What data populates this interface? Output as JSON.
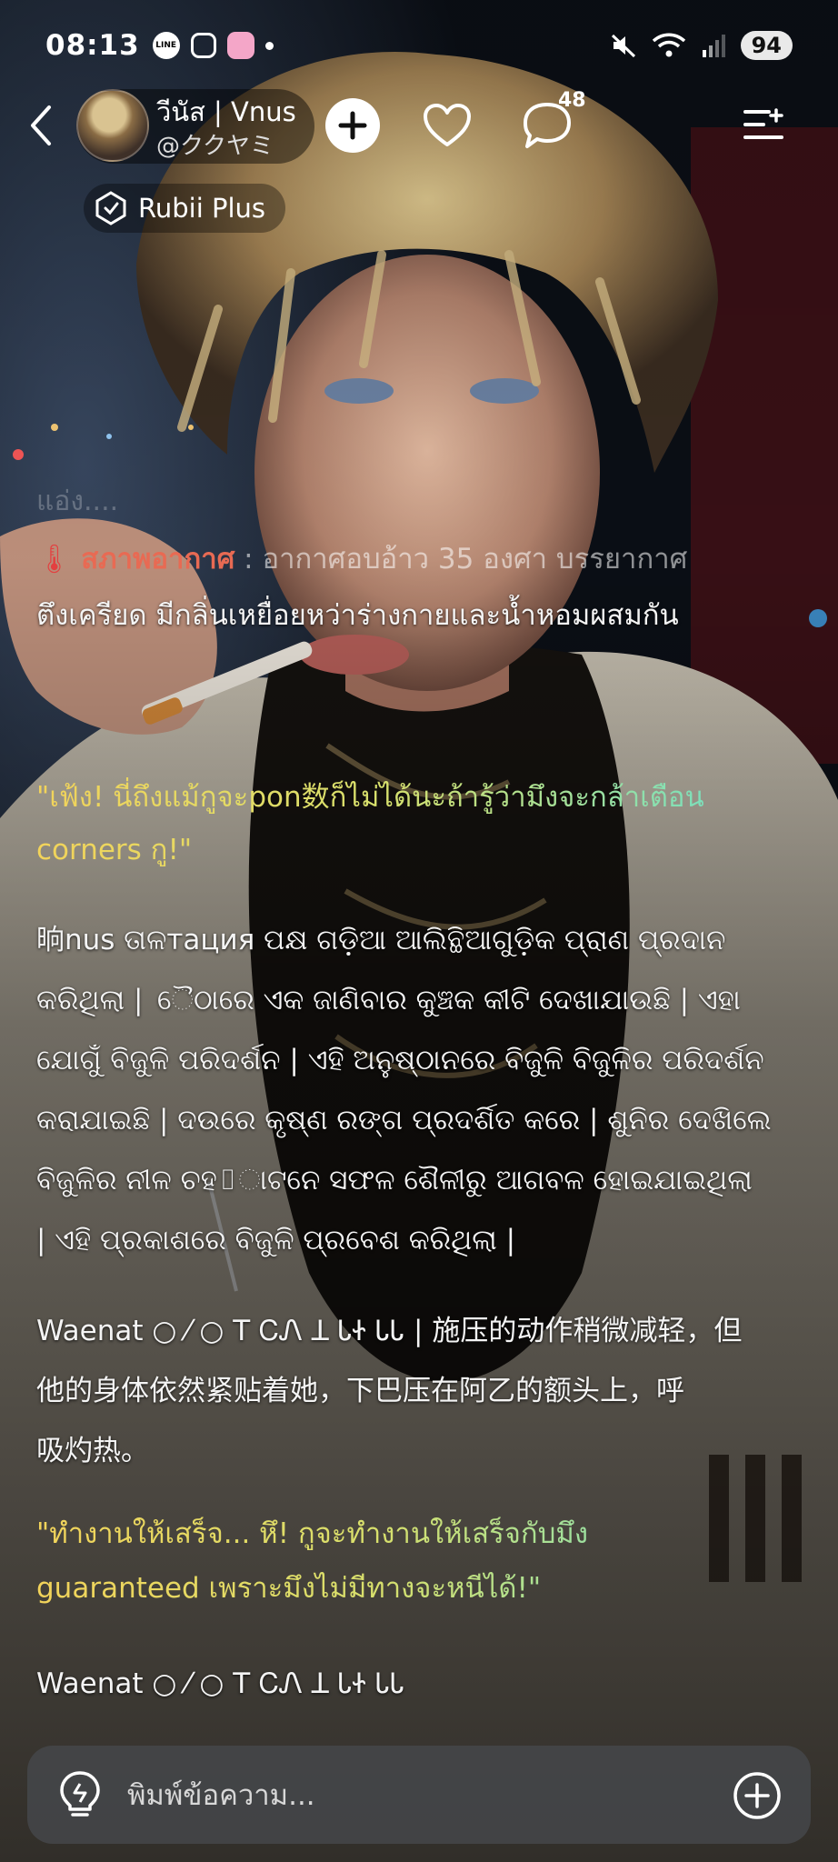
{
  "status_bar": {
    "time": "08:13",
    "battery": "94",
    "apps": [
      "LINE",
      "Instagram",
      "pink-app"
    ]
  },
  "header": {
    "character_name": "วีนัส | Vnus",
    "character_handle": "@ククヤミ",
    "comment_count": "48",
    "plan_label": "Rubii Plus"
  },
  "chat": {
    "faded_top": "แอ่ง....",
    "weather_emoji": "🌡",
    "weather_label": "สภาพอากาศ",
    "weather_text": ": อากาศอบอ้าว 35 องศา บรรยากาศ",
    "line_2": "ตึงเครียด มีกลิ่นเหยื่อยหว่าร่างกายและน้ำหอมผสมกัน",
    "quote_1_line_1": "\"เฟ้ง! นี่ถึงแม้กูจะpon数ก็ไม่ได้นะถ้ารู้ว่ามึงจะกล้าเตือน",
    "quote_1_line_2": "corners กู!\"",
    "para_1_lines": [
      "晌nus ତାଳтация ପକ୍ଷ ଗଡ଼ିଆ ଆଲିନ୍ଥିଆଗୁଡ଼ିକ ପ୍ରାଣ ପ୍ରଦାନ",
      "କରିଥିଲା | ୈଠାରେ ଏକ ଜାଣିବାର କୁଞ୍ଚକ କୀଟି ଦେଖାଯାଉଛି | ଏହା",
      "ଯୋଗୁଁ ବିଜୁଳି ପରିଦର୍ଶନ | ଏହି ଅନୁଷ୍ଠାନରେ ବିଜୁଳି ବିଜୁଳିର ପରିଦର୍ଶନ",
      "କରାଯାଇଛି | ଦଉରେ କୃଷ୍ଣ ରଙ୍ଗ ପ୍ରଦର୍ଶିତ କରେ | ଶୁନିର ଦେଖିଲେ",
      "ବିଜୁଳିର ନୀଳ ଚହ▯ାଟନେ ସଫଳ ଶୈଳୀରୁ ଆଗବଳ ହୋଇଯାଇଥିଲା",
      "| ଏହି ପ୍ରକାଶରେ ବିଜୁଳି ପ୍ରବେଶ କରିଥିଲା |"
    ],
    "para_2_lines": [
      "Waenat ○ ⁄ ○ ꓔ ᏟᏁ ꓕ ᏓᏐ ᏓᏓ | 施压的动作稍微减轻，但",
      "他的身体依然紧贴着她，下巴压在阿乙的额头上，呼",
      "吸灼热。"
    ],
    "quote_2_line_1": "\"ทำงานให้เสร็จ... หึ! กูจะทำงานให้เสร็จกับมึง",
    "quote_2_line_2": "guaranteed เพราะมึงไม่มีทางจะหนีได้!\"",
    "para_3": "Waenat ○ ⁄ ○ ꓔ ᏟᏁ ꓕ ᏓᏐ ᏓᏓ"
  },
  "input": {
    "placeholder": "พิมพ์ข้อความ..."
  },
  "colors": {
    "quote_start": "#f2d35a",
    "quote_end": "#5fe0d4",
    "weather_label": "#e86a53",
    "input_bg": "#46484c"
  }
}
